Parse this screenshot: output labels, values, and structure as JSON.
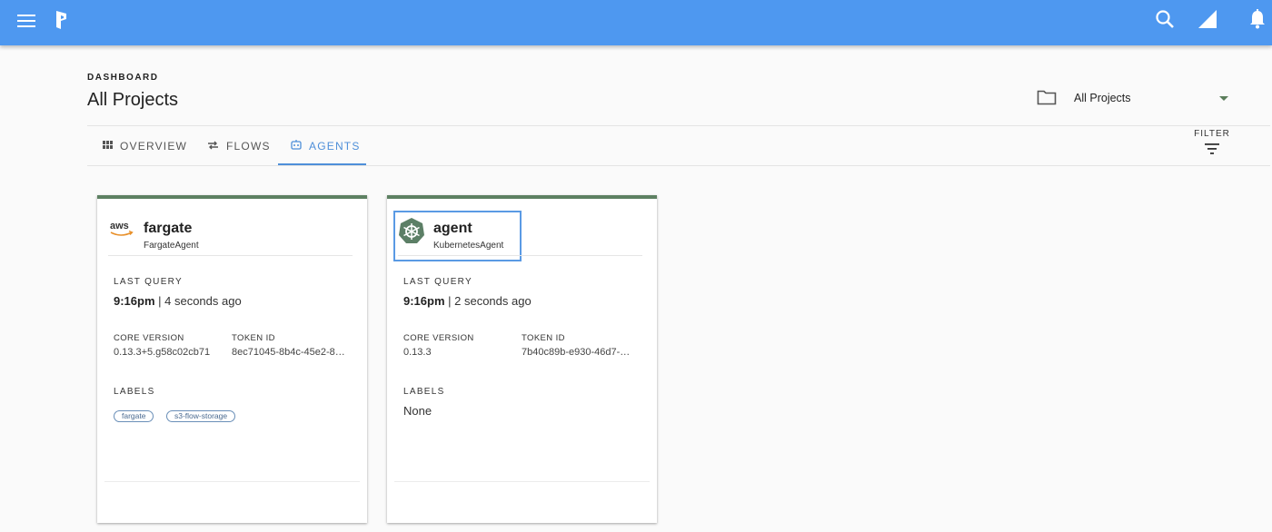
{
  "header": {
    "icons": [
      "menu-icon",
      "prefect-logo-icon",
      "search-icon",
      "signal-icon",
      "bell-icon"
    ],
    "color": "#4e98f0"
  },
  "page": {
    "eyebrow": "DASHBOARD",
    "title": "All Projects"
  },
  "project_selector": {
    "value": "All Projects"
  },
  "tabs": [
    {
      "label": "OVERVIEW",
      "icon": "grid-icon",
      "active": false
    },
    {
      "label": "FLOWS",
      "icon": "flows-icon",
      "active": false
    },
    {
      "label": "AGENTS",
      "icon": "agent-icon",
      "active": true
    }
  ],
  "filter": {
    "label": "FILTER"
  },
  "agents": [
    {
      "name": "fargate",
      "type": "FargateAgent",
      "icon": "aws-logo-icon",
      "last_query_label": "LAST QUERY",
      "last_query_time": "9:16pm",
      "last_query_rel": " | 4 seconds ago",
      "core_version_label": "CORE VERSION",
      "core_version": "0.13.3+5.g58c02cb71",
      "token_id_label": "TOKEN ID",
      "token_id": "8ec71045-8b4c-45e2-8…",
      "labels_label": "LABELS",
      "labels": [
        "fargate",
        "s3-flow-storage"
      ]
    },
    {
      "name": "agent",
      "type": "KubernetesAgent",
      "icon": "kubernetes-helm-icon",
      "last_query_label": "LAST QUERY",
      "last_query_time": "9:16pm",
      "last_query_rel": " | 2 seconds ago",
      "core_version_label": "CORE VERSION",
      "core_version": "0.13.3",
      "token_id_label": "TOKEN ID",
      "token_id": "7b40c89b-e930-46d7-…",
      "labels_label": "LABELS",
      "labels_none": "None"
    }
  ],
  "colors": {
    "accent": "#4e8fd9",
    "card_top": "#5d8062",
    "chip_border": "#6a8fb8"
  }
}
